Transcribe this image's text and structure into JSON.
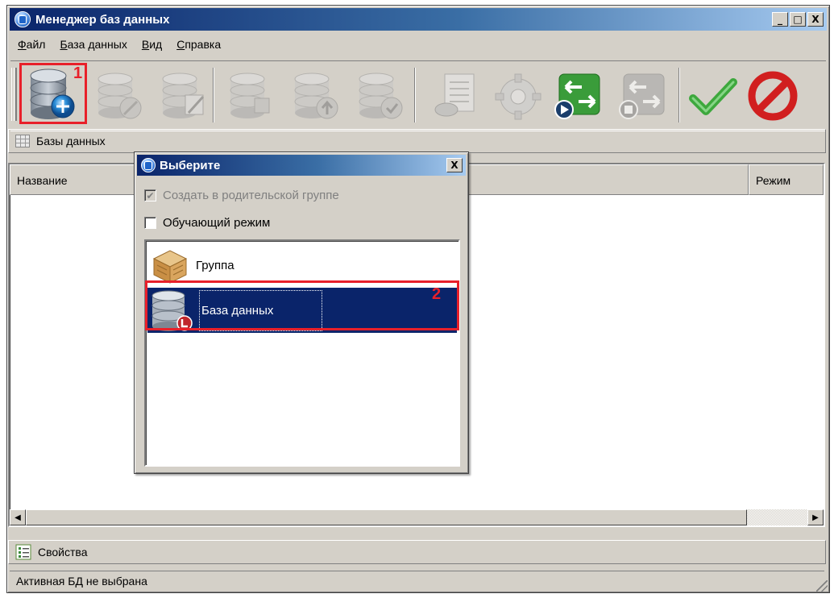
{
  "window": {
    "title": "Менеджер баз данных",
    "controls": [
      "_",
      "□",
      "X"
    ]
  },
  "menu": [
    {
      "label": "Файл",
      "underline": "Ф",
      "rest": "айл"
    },
    {
      "label": "База данных",
      "underline": "Б",
      "rest": "аза данных"
    },
    {
      "label": "Вид",
      "underline": "В",
      "rest": "ид"
    },
    {
      "label": "Справка",
      "underline": "С",
      "rest": "правка"
    }
  ],
  "toolbar": {
    "buttons": [
      {
        "icon": "database-add-icon",
        "enabled": true
      },
      {
        "icon": "database-delete-icon",
        "enabled": false
      },
      {
        "icon": "database-edit-icon",
        "enabled": false
      },
      {
        "icon": "database-copy-icon",
        "enabled": false
      },
      {
        "icon": "database-up-icon",
        "enabled": false
      },
      {
        "icon": "database-check-icon",
        "enabled": false
      },
      {
        "icon": "document-icon",
        "enabled": false
      },
      {
        "icon": "gear-icon",
        "enabled": false
      },
      {
        "icon": "import-green-icon",
        "enabled": true
      },
      {
        "icon": "import-gray-icon",
        "enabled": false
      },
      {
        "icon": "checkmark-icon",
        "enabled": true
      },
      {
        "icon": "cancel-icon",
        "enabled": true
      }
    ],
    "annotation_marker": "1"
  },
  "databases_panel": {
    "title": "Базы данных",
    "columns": [
      "Название",
      "Режим"
    ]
  },
  "properties_panel": {
    "title": "Свойства"
  },
  "status": {
    "text": "Активная БД не выбрана"
  },
  "dialog": {
    "title": "Выберите",
    "close_label": "X",
    "checkbox_parent": {
      "label": "Создать в родительской группе",
      "checked": true,
      "disabled": true
    },
    "checkbox_training": {
      "label": "Обучающий режим",
      "checked": false,
      "disabled": false
    },
    "items": [
      {
        "label": "Группа",
        "icon": "box-icon",
        "selected": false
      },
      {
        "label": "База данных",
        "icon": "database-icon",
        "selected": true
      }
    ],
    "annotation_marker": "2"
  },
  "colors": {
    "accent": "#0a246a",
    "annotation": "#e8202a",
    "face": "#d4d0c8"
  }
}
